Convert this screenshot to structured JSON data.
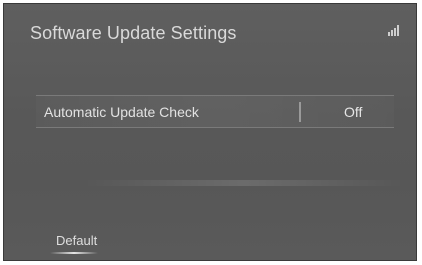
{
  "screen": {
    "title": "Software Update Settings",
    "status_icon": "signal-icon"
  },
  "settings": {
    "rows": [
      {
        "label": "Automatic Update Check",
        "value": "Off"
      }
    ]
  },
  "footer": {
    "default_label": "Default"
  }
}
